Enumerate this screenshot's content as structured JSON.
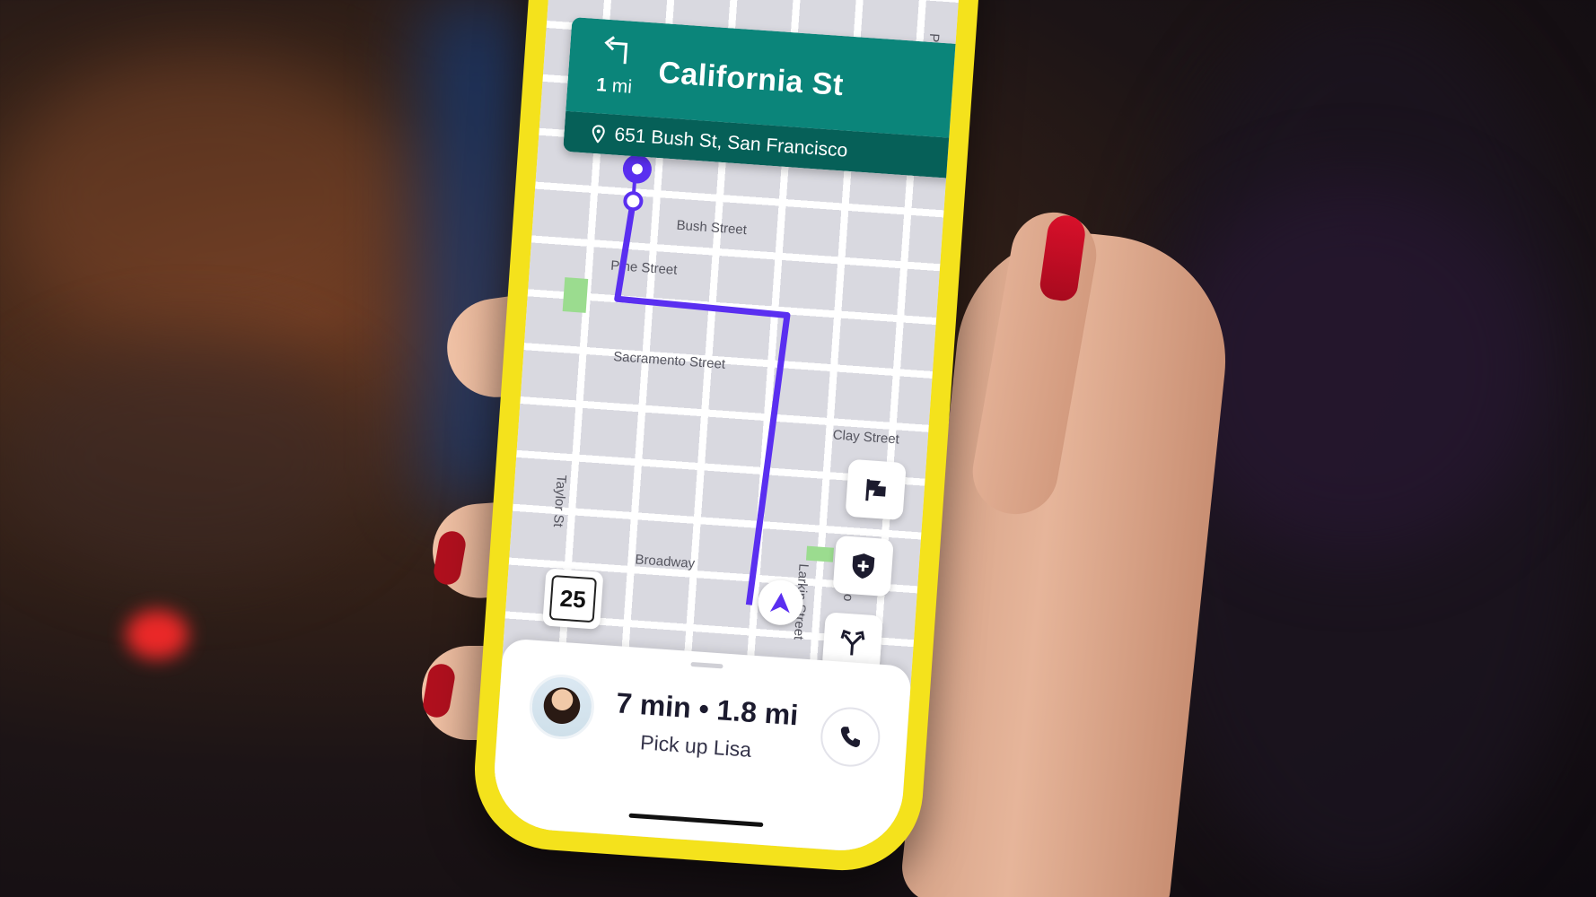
{
  "navigation": {
    "turn_icon": "turn-left-icon",
    "distance_value": "1",
    "distance_unit": "mi",
    "street": "California St",
    "destination_icon": "map-pin-icon",
    "destination": "651 Bush St, San Francisco"
  },
  "map": {
    "streets": {
      "bush": "Bush Street",
      "pine": "Pine Street",
      "sacramento": "Sacramento Street",
      "clay": "Clay Street",
      "broadway": "Broadway",
      "taylor": "Taylor St",
      "larkin": "Larkin Street",
      "polk": "Polk St",
      "po": "Po"
    },
    "speed_limit": "25",
    "buttons": {
      "flag": "flag-icon",
      "safety": "shield-plus-icon",
      "route_options": "fork-arrow-icon"
    },
    "route_color": "#5a2ff0"
  },
  "trip": {
    "summary": "7 min • 1.8 mi",
    "task": "Pick up Lisa",
    "call_icon": "phone-icon"
  },
  "colors": {
    "banner": "#0b857a",
    "banner_dark": "#066058",
    "phone_case": "#f4e21c"
  }
}
